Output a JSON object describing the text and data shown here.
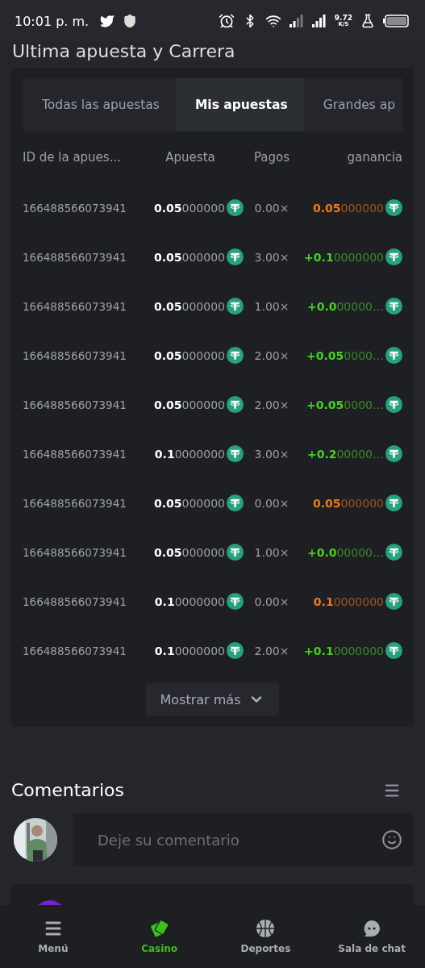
{
  "status_bar": {
    "time": "10:01 p. m.",
    "speed_value": "9.72",
    "speed_unit": "K/S"
  },
  "section_title": "Ultima apuesta y Carrera",
  "tabs": [
    {
      "label": "Todas las apuestas",
      "selected": false
    },
    {
      "label": "Mis apuestas",
      "selected": true
    },
    {
      "label": "Grandes ap",
      "selected": false
    }
  ],
  "table": {
    "columns": [
      "ID de la apues...",
      "Apuesta",
      "Pagos",
      "ganancia"
    ],
    "rows": [
      {
        "id": "166488566073941",
        "bet": "**0.05**000000",
        "payout": "0.00×",
        "profit": "**0.05**000000",
        "kind": "loss"
      },
      {
        "id": "166488566073941",
        "bet": "**0.05**000000",
        "payout": "3.00×",
        "profit": "**+0.1**0000000",
        "kind": "win"
      },
      {
        "id": "166488566073941",
        "bet": "**0.05**000000",
        "payout": "1.00×",
        "profit": "**+0.0**00000…",
        "kind": "win"
      },
      {
        "id": "166488566073941",
        "bet": "**0.05**000000",
        "payout": "2.00×",
        "profit": "**+0.05**0000…",
        "kind": "win"
      },
      {
        "id": "166488566073941",
        "bet": "**0.05**000000",
        "payout": "2.00×",
        "profit": "**+0.05**0000…",
        "kind": "win"
      },
      {
        "id": "166488566073941",
        "bet": "**0.1**0000000",
        "payout": "3.00×",
        "profit": "**+0.2**00000…",
        "kind": "win"
      },
      {
        "id": "166488566073941",
        "bet": "**0.05**000000",
        "payout": "0.00×",
        "profit": "**0.05**000000",
        "kind": "loss"
      },
      {
        "id": "166488566073941",
        "bet": "**0.05**000000",
        "payout": "1.00×",
        "profit": "**+0.0**00000…",
        "kind": "win"
      },
      {
        "id": "166488566073941",
        "bet": "**0.1**0000000",
        "payout": "0.00×",
        "profit": "**0.1**0000000",
        "kind": "loss"
      },
      {
        "id": "166488566073941",
        "bet": "**0.1**0000000",
        "payout": "2.00×",
        "profit": "**+0.1**0000000",
        "kind": "win"
      }
    ]
  },
  "show_more": "Mostrar más",
  "comments": {
    "title": "Comentarios",
    "placeholder": "Deje su comentario"
  },
  "nav": [
    {
      "label": "Menú",
      "kind": "menu",
      "selected": false
    },
    {
      "label": "Casino",
      "kind": "casino",
      "selected": true
    },
    {
      "label": "Deportes",
      "kind": "sports",
      "selected": false
    },
    {
      "label": "Sala de chat",
      "kind": "chat",
      "selected": false
    }
  ]
}
